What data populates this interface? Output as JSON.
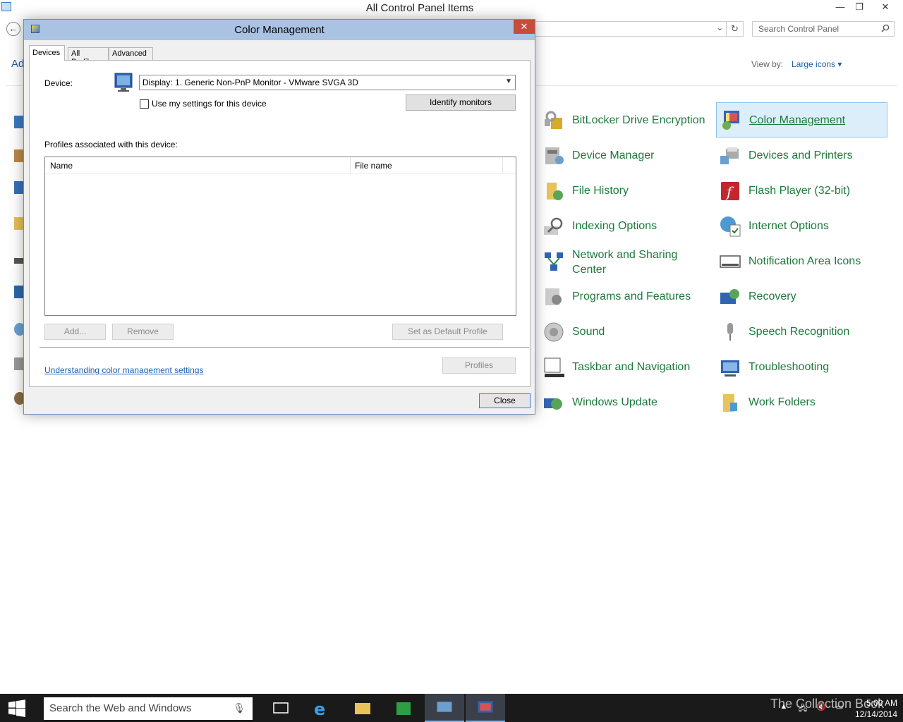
{
  "window": {
    "title": "All Control Panel Items",
    "min_glyph": "—",
    "max_glyph": "❐",
    "close_glyph": "✕"
  },
  "nav": {
    "back_glyph": "←",
    "address_chevron": "⌄",
    "refresh_glyph": "↻",
    "search_placeholder": "Search Control Panel"
  },
  "header": {
    "adjust_text": "Ad",
    "view_by_label": "View by:",
    "view_by_value": "Large icons ▾"
  },
  "items": [
    {
      "label": "BitLocker Drive Encryption",
      "icon": "bitlocker-icon"
    },
    {
      "label": "Color Management",
      "icon": "color-management-icon",
      "selected": true
    },
    {
      "label": "Device Manager",
      "icon": "device-manager-icon"
    },
    {
      "label": "Devices and Printers",
      "icon": "devices-printers-icon"
    },
    {
      "label": "File History",
      "icon": "file-history-icon"
    },
    {
      "label": "Flash Player (32-bit)",
      "icon": "flash-player-icon"
    },
    {
      "label": "Indexing Options",
      "icon": "indexing-options-icon"
    },
    {
      "label": "Internet Options",
      "icon": "internet-options-icon"
    },
    {
      "label": "Network and Sharing Center",
      "icon": "network-sharing-icon"
    },
    {
      "label": "Notification Area Icons",
      "icon": "notification-area-icon"
    },
    {
      "label": "Programs and Features",
      "icon": "programs-features-icon"
    },
    {
      "label": "Recovery",
      "icon": "recovery-icon"
    },
    {
      "label": "Sound",
      "icon": "sound-icon"
    },
    {
      "label": "Speech Recognition",
      "icon": "speech-recognition-icon"
    },
    {
      "label": "Taskbar and Navigation",
      "icon": "taskbar-navigation-icon"
    },
    {
      "label": "Troubleshooting",
      "icon": "troubleshooting-icon"
    },
    {
      "label": "Windows Update",
      "icon": "windows-update-icon"
    },
    {
      "label": "Work Folders",
      "icon": "work-folders-icon"
    }
  ],
  "dialog": {
    "title": "Color Management",
    "close_glyph": "✕",
    "tabs": [
      "Devices",
      "All Profiles",
      "Advanced"
    ],
    "device_label": "Device:",
    "device_value": "Display: 1. Generic Non-PnP Monitor - VMware SVGA 3D",
    "select_arrow": "▼",
    "use_settings_label": "Use my settings for this device",
    "identify_button": "Identify monitors",
    "profiles_heading": "Profiles associated with this device:",
    "columns": [
      "Name",
      "File name"
    ],
    "add_button": "Add...",
    "remove_button": "Remove",
    "default_button": "Set as Default Profile",
    "understanding_link": "Understanding color management settings",
    "profiles_button": "Profiles",
    "close_button": "Close"
  },
  "taskbar": {
    "search_placeholder": "Search the Web and Windows",
    "mic_glyph": "🎙",
    "edition_text": "The Collection Book",
    "time": "5:00 AM",
    "date": "12/14/2014"
  },
  "colors": {
    "link_green": "#1d7a3c",
    "link_blue": "#1e5fa6",
    "dialog_title_bar": "#aac3e3",
    "dialog_close": "#c64c3e",
    "taskbar": "#1a1a1a"
  }
}
